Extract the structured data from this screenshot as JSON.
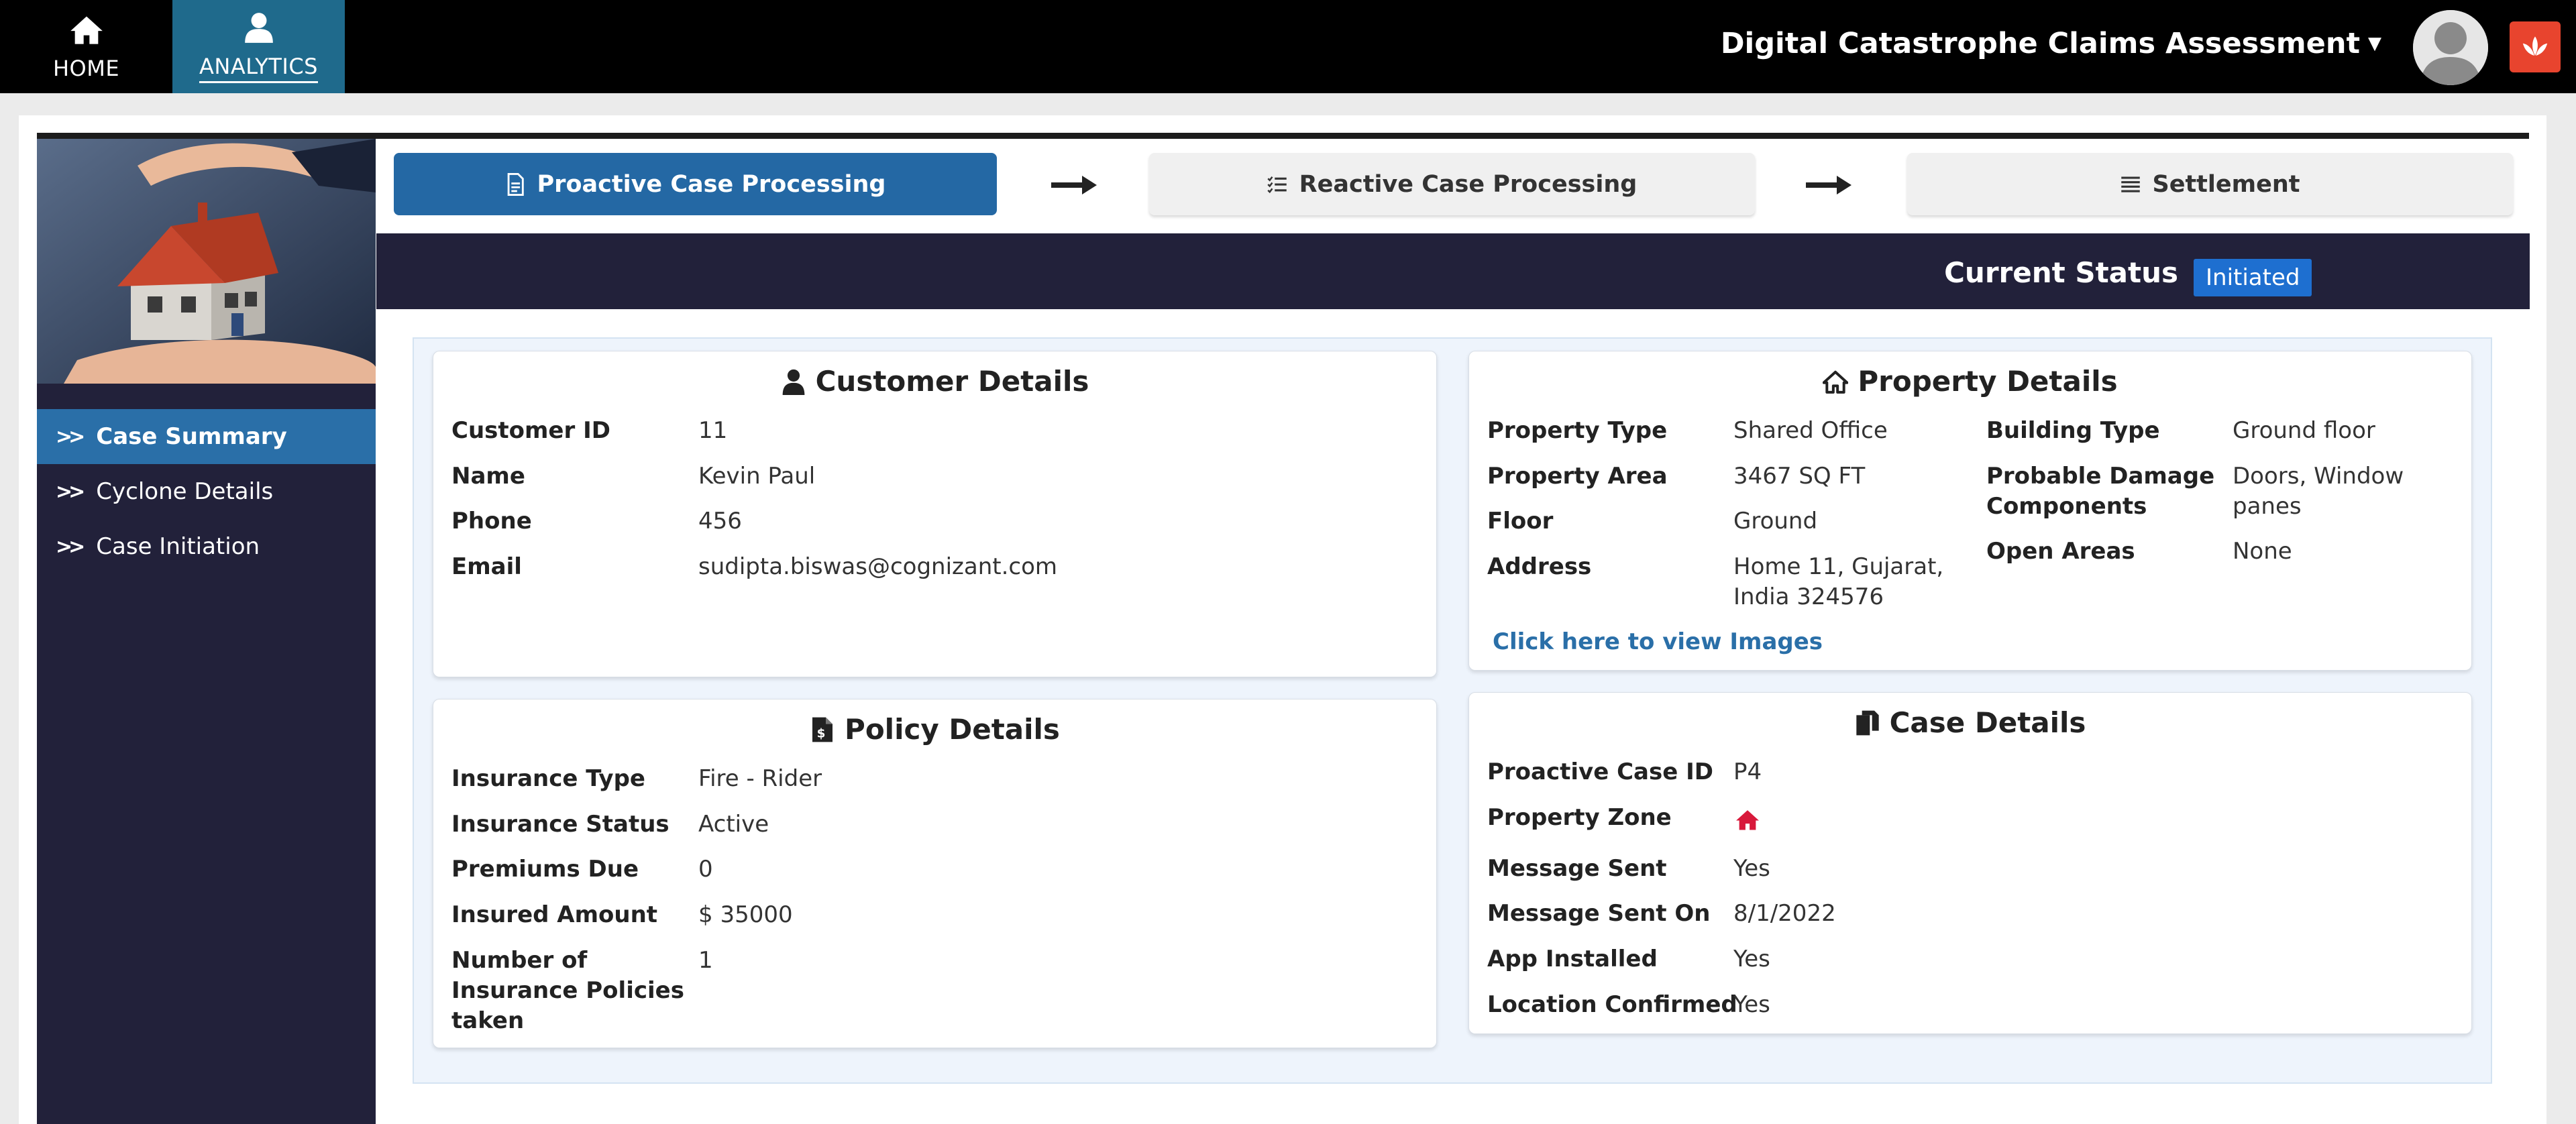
{
  "topnav": {
    "home_label": "HOME",
    "analytics_label": "ANALYTICS",
    "app_title": "Digital Catastrophe Claims Assessment"
  },
  "sidebar": {
    "items": [
      {
        "label": "Case Summary",
        "active": true
      },
      {
        "label": "Cyclone Details",
        "active": false
      },
      {
        "label": "Case Initiation",
        "active": false
      }
    ]
  },
  "steps": [
    {
      "label": "Proactive Case Processing",
      "active": true
    },
    {
      "label": "Reactive Case Processing",
      "active": false
    },
    {
      "label": "Settlement",
      "active": false
    }
  ],
  "status": {
    "label": "Current Status",
    "value": "Initiated"
  },
  "customer": {
    "title": "Customer Details",
    "rows": [
      {
        "label": "Customer ID",
        "value": "11"
      },
      {
        "label": "Name",
        "value": "Kevin Paul"
      },
      {
        "label": "Phone",
        "value": "456"
      },
      {
        "label": "Email",
        "value": "sudipta.biswas@cognizant.com"
      }
    ]
  },
  "property": {
    "title": "Property Details",
    "left_rows": [
      {
        "label": "Property Type",
        "value": "Shared Office"
      },
      {
        "label": "Property Area",
        "value": "3467 SQ FT"
      },
      {
        "label": "Floor",
        "value": "Ground"
      },
      {
        "label": "Address",
        "value_line1": "Home 11, Gujarat,",
        "value_line2": "India 324576"
      }
    ],
    "right_rows": [
      {
        "label": "Building Type",
        "value": "Ground floor"
      },
      {
        "label_line1": "Probable Damage",
        "label_line2": "Components",
        "value": "Doors, Window panes"
      },
      {
        "label": "Open Areas",
        "value": "None"
      }
    ],
    "images_link": "Click here to view Images"
  },
  "policy": {
    "title": "Policy Details",
    "rows": [
      {
        "label": "Insurance Type",
        "value": "Fire - Rider"
      },
      {
        "label": "Insurance Status",
        "value": "Active"
      },
      {
        "label": "Premiums Due",
        "value": "0"
      },
      {
        "label": "Insured Amount",
        "value": "$ 35000"
      },
      {
        "label_line1": "Number of",
        "label_line2": "Insurance Policies",
        "label_line3": "taken",
        "value": "1"
      }
    ]
  },
  "case": {
    "title": "Case Details",
    "rows": [
      {
        "label": "Proactive Case ID",
        "value": "P4"
      },
      {
        "label": "Property Zone",
        "icon": "home-icon",
        "icon_color": "#d8193b"
      },
      {
        "label": "Message Sent",
        "value": "Yes"
      },
      {
        "label": "Message Sent On",
        "value": "8/1/2022"
      },
      {
        "label": "App Installed",
        "value": "Yes"
      },
      {
        "label": "Location Confirmed",
        "value": "Yes"
      }
    ]
  },
  "colors": {
    "brand_blue": "#2468a4",
    "sidebar_bg": "#22213a",
    "status_badge": "#1e6fd0",
    "logo_red": "#e8442e",
    "zone_red": "#d8193b"
  }
}
